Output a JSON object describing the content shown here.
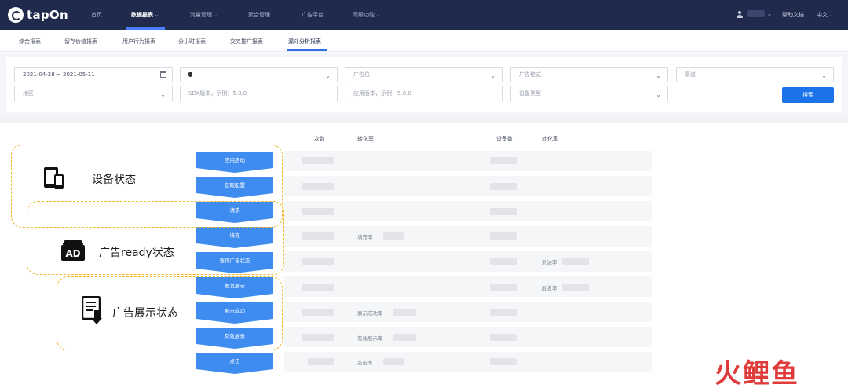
{
  "brand": {
    "name": "tapOn"
  },
  "topnav": {
    "items": [
      {
        "label": "首页"
      },
      {
        "label": "数据报表"
      },
      {
        "label": "流量管理"
      },
      {
        "label": "聚合管理"
      },
      {
        "label": "广告平台"
      },
      {
        "label": "高级功能"
      }
    ],
    "help": "帮助文档",
    "language": "中文"
  },
  "subtabs": [
    "综合报表",
    "留存价值报表",
    "用户行为报表",
    "分小时报表",
    "交叉推广报表",
    "漏斗分析报表"
  ],
  "filters": {
    "date_range": "2021-04-28 ~ 2021-05-11",
    "platform_placeholder": "",
    "placement_placeholder": "广告位",
    "ad_source_placeholder": "广告格式",
    "channel_placeholder": "渠道",
    "region_placeholder": "地区",
    "sdk_version_placeholder": "SDK版本，示例：5.8.0",
    "app_version_placeholder": "应用版本，示例：5.0.0",
    "device_type_placeholder": "设备类型",
    "search_label": "搜索"
  },
  "table": {
    "headers": [
      "次数",
      "转化率",
      "设备数",
      "转化率"
    ],
    "rate_labels": {
      "fill": "填充率",
      "reach": "到达率",
      "trigger": "触发率",
      "show_success": "展示成功率",
      "valid_show": "有效展示率",
      "click": "点击率"
    }
  },
  "steps": [
    "应用启动",
    "获取配置",
    "请求",
    "填充",
    "查询广告状态",
    "触发展示",
    "展示成功",
    "有效展示",
    "点击"
  ],
  "groups": {
    "device": "设备状态",
    "ad_ready": "广告ready状态",
    "ad_display": "广告展示状态"
  },
  "watermark": "火鲤鱼",
  "colors": {
    "nav_bg": "#1f2a4d",
    "step_blue": "#3f8cf0",
    "dash_yellow": "#f0b323",
    "search_button": "#1a73e8",
    "watermark": "#e03b3b"
  }
}
